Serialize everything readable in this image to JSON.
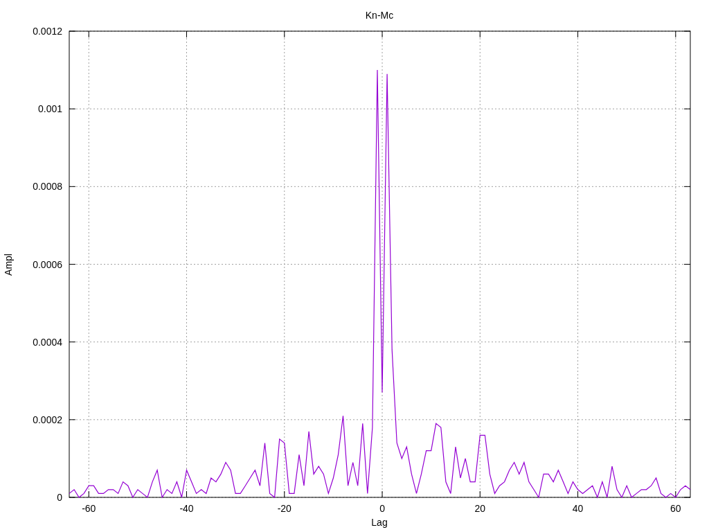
{
  "chart_data": {
    "type": "line",
    "title": "Kn-Mc",
    "xlabel": "Lag",
    "ylabel": "Ampl",
    "x": [
      -64,
      -63,
      -62,
      -61,
      -60,
      -59,
      -58,
      -57,
      -56,
      -55,
      -54,
      -53,
      -52,
      -51,
      -50,
      -49,
      -48,
      -47,
      -46,
      -45,
      -44,
      -43,
      -42,
      -41,
      -40,
      -39,
      -38,
      -37,
      -36,
      -35,
      -34,
      -33,
      -32,
      -31,
      -30,
      -29,
      -28,
      -27,
      -26,
      -25,
      -24,
      -23,
      -22,
      -21,
      -20,
      -19,
      -18,
      -17,
      -16,
      -15,
      -14,
      -13,
      -12,
      -11,
      -10,
      -9,
      -8,
      -7,
      -6,
      -5,
      -4,
      -3,
      -2,
      -1,
      0,
      1,
      2,
      3,
      4,
      5,
      6,
      7,
      8,
      9,
      10,
      11,
      12,
      13,
      14,
      15,
      16,
      17,
      18,
      19,
      20,
      21,
      22,
      23,
      24,
      25,
      26,
      27,
      28,
      29,
      30,
      31,
      32,
      33,
      34,
      35,
      36,
      37,
      38,
      39,
      40,
      41,
      42,
      43,
      44,
      45,
      46,
      47,
      48,
      49,
      50,
      51,
      52,
      53,
      54,
      55,
      56,
      57,
      58,
      59,
      60,
      61,
      62,
      63
    ],
    "series": [
      {
        "color": "#9400d3",
        "values": [
          1e-05,
          2e-05,
          0,
          1e-05,
          3e-05,
          3e-05,
          1e-05,
          1e-05,
          2e-05,
          2e-05,
          1e-05,
          4e-05,
          3e-05,
          0,
          2e-05,
          1e-05,
          0,
          4e-05,
          7e-05,
          0,
          2e-05,
          1e-05,
          4e-05,
          0,
          7e-05,
          4e-05,
          1e-05,
          2e-05,
          1e-05,
          5e-05,
          4e-05,
          6e-05,
          9e-05,
          7e-05,
          1e-05,
          1e-05,
          3e-05,
          5e-05,
          7e-05,
          3e-05,
          0.00014,
          1e-05,
          0,
          0.00015,
          0.00014,
          1e-05,
          1e-05,
          0.00011,
          3e-05,
          0.00017,
          6e-05,
          8e-05,
          6e-05,
          1e-05,
          5e-05,
          0.00011,
          0.00021,
          3e-05,
          9e-05,
          3e-05,
          0.00019,
          1e-05,
          0.00018,
          0.0011,
          0.00027,
          0.00109,
          0.00038,
          0.00014,
          0.0001,
          0.00013,
          6e-05,
          1e-05,
          6e-05,
          0.00012,
          0.00012,
          0.00019,
          0.00018,
          4e-05,
          1e-05,
          0.00013,
          5e-05,
          0.0001,
          4e-05,
          4e-05,
          0.00016,
          0.00016,
          6e-05,
          1e-05,
          3e-05,
          4e-05,
          7e-05,
          9e-05,
          6e-05,
          9e-05,
          4e-05,
          2e-05,
          0,
          6e-05,
          6e-05,
          4e-05,
          7e-05,
          4e-05,
          1e-05,
          4e-05,
          2e-05,
          1e-05,
          2e-05,
          3e-05,
          0,
          4e-05,
          0,
          8e-05,
          2e-05,
          0,
          3e-05,
          0,
          1e-05,
          2e-05,
          2e-05,
          3e-05,
          5e-05,
          1e-05,
          0,
          1e-05,
          0,
          2e-05,
          3e-05,
          2e-05
        ]
      }
    ],
    "grid": true,
    "xlim": [
      -64,
      63
    ],
    "ylim": [
      0,
      0.0012
    ],
    "xticks": [
      -60,
      -40,
      -20,
      0,
      20,
      40,
      60
    ],
    "yticks": [
      {
        "value": 0,
        "label": "0"
      },
      {
        "value": 0.0002,
        "label": "0.0002"
      },
      {
        "value": 0.0004,
        "label": "0.0004"
      },
      {
        "value": 0.0006,
        "label": "0.0006"
      },
      {
        "value": 0.0008,
        "label": "0.0008"
      },
      {
        "value": 0.001,
        "label": "0.001"
      },
      {
        "value": 0.0012,
        "label": "0.0012"
      }
    ]
  }
}
